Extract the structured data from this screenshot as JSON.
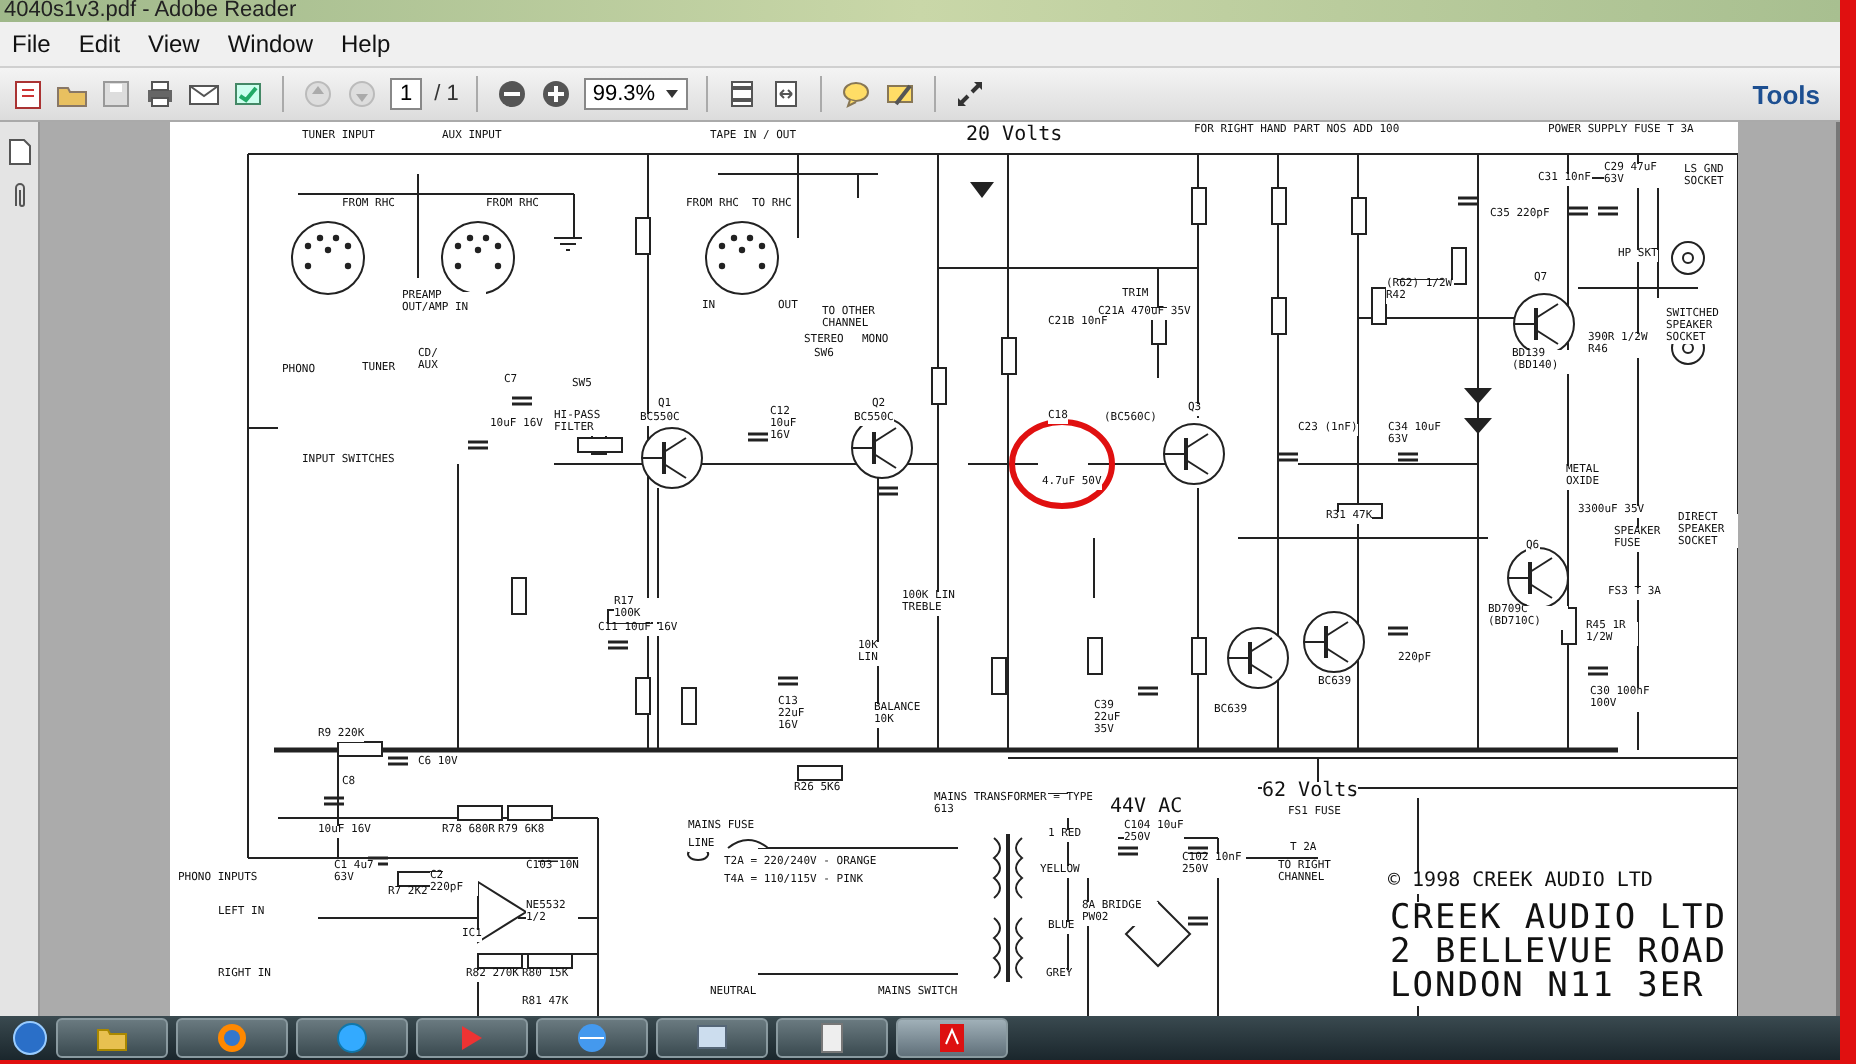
{
  "window": {
    "title": "4040s1v3.pdf - Adobe Reader"
  },
  "menu": [
    "File",
    "Edit",
    "View",
    "Window",
    "Help"
  ],
  "toolbar": {
    "page_field": "1",
    "page_total": "/ 1",
    "zoom": "99.3%",
    "tools": "Tools"
  },
  "schematic": {
    "labels": [
      {
        "text": "TUNER INPUT",
        "kind": "label"
      },
      {
        "text": "AUX INPUT",
        "kind": "label"
      },
      {
        "text": "TAPE IN / OUT",
        "kind": "label"
      },
      {
        "text": "20 Volts",
        "kind": "heading"
      },
      {
        "text": "FOR RIGHT HAND PART NOS ADD 100",
        "kind": "label"
      },
      {
        "text": "POWER SUPPLY FUSE T 3A",
        "kind": "label"
      },
      {
        "text": "FROM RHC",
        "kind": "label"
      },
      {
        "text": "FROM RHC",
        "kind": "label"
      },
      {
        "text": "FROM RHC",
        "kind": "label"
      },
      {
        "text": "TO RHC",
        "kind": "label"
      },
      {
        "text": "PREAMP OUT/AMP IN",
        "kind": "label"
      },
      {
        "text": "IN",
        "kind": "label"
      },
      {
        "text": "OUT",
        "kind": "label"
      },
      {
        "text": "TO OTHER CHANNEL",
        "kind": "label"
      },
      {
        "text": "STEREO",
        "kind": "label"
      },
      {
        "text": "MONO",
        "kind": "label"
      },
      {
        "text": "SW6",
        "kind": "label"
      },
      {
        "text": "PHONO",
        "kind": "label"
      },
      {
        "text": "TUNER",
        "kind": "label"
      },
      {
        "text": "CD/ AUX",
        "kind": "label"
      },
      {
        "text": "INPUT SWITCHES",
        "kind": "label"
      },
      {
        "text": "C7",
        "kind": "label"
      },
      {
        "text": "10uF 16V",
        "kind": "label"
      },
      {
        "text": "SW5",
        "kind": "label"
      },
      {
        "text": "HI-PASS FILTER",
        "kind": "label"
      },
      {
        "text": "Q1",
        "kind": "label"
      },
      {
        "text": "BC550C",
        "kind": "label"
      },
      {
        "text": "C12 10uF 16V",
        "kind": "label"
      },
      {
        "text": "Q2",
        "kind": "label"
      },
      {
        "text": "BC550C",
        "kind": "label"
      },
      {
        "text": "C13 22uF 16V",
        "kind": "label"
      },
      {
        "text": "10K LIN",
        "kind": "label"
      },
      {
        "text": "100K LIN TREBLE",
        "kind": "label"
      },
      {
        "text": "BALANCE 10K",
        "kind": "label"
      },
      {
        "text": "R17 100K",
        "kind": "label"
      },
      {
        "text": "C11 10uF 16V",
        "kind": "label"
      },
      {
        "text": "R9 220K",
        "kind": "label"
      },
      {
        "text": "C6 10V",
        "kind": "label"
      },
      {
        "text": "C8",
        "kind": "label"
      },
      {
        "text": "10uF 16V",
        "kind": "label"
      },
      {
        "text": "R78 680R",
        "kind": "label"
      },
      {
        "text": "R79 6K8",
        "kind": "label"
      },
      {
        "text": "R26 5K6",
        "kind": "label"
      },
      {
        "text": "PHONO INPUTS",
        "kind": "label"
      },
      {
        "text": "LEFT IN",
        "kind": "label"
      },
      {
        "text": "RIGHT IN",
        "kind": "label"
      },
      {
        "text": "C1 4u7 63V",
        "kind": "label"
      },
      {
        "text": "R7 2K2",
        "kind": "label"
      },
      {
        "text": "C2 220pF",
        "kind": "label"
      },
      {
        "text": "IC1",
        "kind": "label"
      },
      {
        "text": "C103 10N",
        "kind": "label"
      },
      {
        "text": "NE5532 1/2",
        "kind": "label"
      },
      {
        "text": "R82 270K",
        "kind": "label"
      },
      {
        "text": "R80 15K",
        "kind": "label"
      },
      {
        "text": "R81 47K",
        "kind": "label"
      },
      {
        "text": "MAINS TRANSFORMER = TYPE 613",
        "kind": "label"
      },
      {
        "text": "MAINS FUSE",
        "kind": "label"
      },
      {
        "text": "LINE",
        "kind": "label"
      },
      {
        "text": "T2A = 220/240V - ORANGE",
        "kind": "label"
      },
      {
        "text": "T4A = 110/115V - PINK",
        "kind": "label"
      },
      {
        "text": "NEUTRAL",
        "kind": "label"
      },
      {
        "text": "MAINS SWITCH",
        "kind": "label"
      },
      {
        "text": "44V AC",
        "kind": "heading"
      },
      {
        "text": "1 RED",
        "kind": "label"
      },
      {
        "text": "YELLOW",
        "kind": "label"
      },
      {
        "text": "BLUE",
        "kind": "label"
      },
      {
        "text": "GREY",
        "kind": "label"
      },
      {
        "text": "8A BRIDGE PW02",
        "kind": "label"
      },
      {
        "text": "C104 10uF 250V",
        "kind": "label"
      },
      {
        "text": "C102 10nF 250V",
        "kind": "label"
      },
      {
        "text": "62 Volts",
        "kind": "heading"
      },
      {
        "text": "FS1 FUSE",
        "kind": "label"
      },
      {
        "text": "T 2A",
        "kind": "label"
      },
      {
        "text": "TO RIGHT CHANNEL",
        "kind": "label"
      },
      {
        "text": "© 1998 CREEK AUDIO LTD",
        "kind": "heading"
      },
      {
        "text": "CREEK AUDIO LTD",
        "kind": "title"
      },
      {
        "text": "2 BELLEVUE ROAD",
        "kind": "title"
      },
      {
        "text": "LONDON N11 3ER",
        "kind": "title"
      },
      {
        "text": "C18",
        "kind": "label"
      },
      {
        "text": "4.7uF 50V",
        "kind": "label"
      },
      {
        "text": "(BC560C)",
        "kind": "label"
      },
      {
        "text": "Q3",
        "kind": "label"
      },
      {
        "text": "TRIM",
        "kind": "label"
      },
      {
        "text": "C21A 470uF 35V",
        "kind": "label"
      },
      {
        "text": "C21B 10nF",
        "kind": "label"
      },
      {
        "text": "C35 220pF",
        "kind": "label"
      },
      {
        "text": "C31 10nF",
        "kind": "label"
      },
      {
        "text": "C29 47uF 63V",
        "kind": "label"
      },
      {
        "text": "LS GND SOCKET",
        "kind": "label"
      },
      {
        "text": "HP SKT",
        "kind": "label"
      },
      {
        "text": "(R62) 1/2W R42",
        "kind": "label"
      },
      {
        "text": "Q7",
        "kind": "label"
      },
      {
        "text": "BD139 (BD140)",
        "kind": "label"
      },
      {
        "text": "SWITCHED SPEAKER SOCKET",
        "kind": "label"
      },
      {
        "text": "390R 1/2W R46",
        "kind": "label"
      },
      {
        "text": "C23 (1nF)",
        "kind": "label"
      },
      {
        "text": "C34 10uF 63V",
        "kind": "label"
      },
      {
        "text": "R31 47K",
        "kind": "label"
      },
      {
        "text": "METAL OXIDE",
        "kind": "label"
      },
      {
        "text": "3300uF 35V",
        "kind": "label"
      },
      {
        "text": "SPEAKER FUSE",
        "kind": "label"
      },
      {
        "text": "DIRECT SPEAKER SOCKET",
        "kind": "label"
      },
      {
        "text": "FS3 T 3A",
        "kind": "label"
      },
      {
        "text": "Q6",
        "kind": "label"
      },
      {
        "text": "BD709C (BD710C)",
        "kind": "label"
      },
      {
        "text": "R45 1R 1/2W",
        "kind": "label"
      },
      {
        "text": "C30 100nF 100V",
        "kind": "label"
      },
      {
        "text": "BC639",
        "kind": "label"
      },
      {
        "text": "BC639",
        "kind": "label"
      },
      {
        "text": "220pF",
        "kind": "label"
      },
      {
        "text": "C39 22uF 35V",
        "kind": "label"
      }
    ]
  }
}
